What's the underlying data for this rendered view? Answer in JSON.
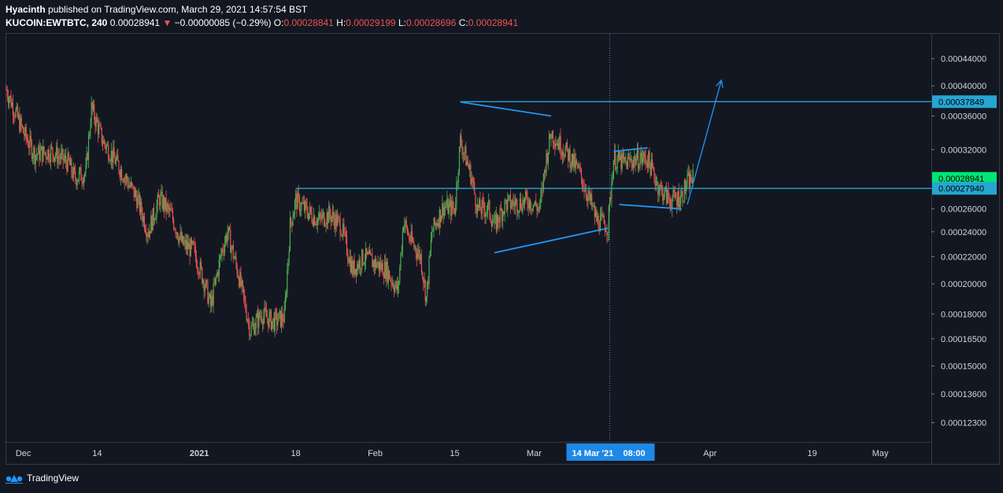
{
  "header": {
    "author": "Hyacinth",
    "published_text": "published on TradingView.com, March 29, 2021 14:57:54 BST",
    "symbol": "KUCOIN:EWTBTC, 240",
    "last_price": "0.00028941",
    "change_arrow": "▼",
    "change": "−0.00000085 (−0.29%)",
    "o_label": "O:",
    "o_value": "0.00028841",
    "h_label": "H:",
    "h_value": "0.00029199",
    "l_label": "L:",
    "l_value": "0.00028696",
    "c_label": "C:",
    "c_value": "0.00028941"
  },
  "footer": {
    "brand": "TradingView"
  },
  "colors": {
    "background": "#131722",
    "up_candle": "#4caf50",
    "down_candle": "#ef5350",
    "drawing_blue": "#2196f3",
    "hline_blue": "#26a6d1",
    "last_price_label": "#00e676",
    "crosshair_label": "#1e88e5"
  },
  "chart_data": {
    "type": "candlestick",
    "price_scale": "log",
    "ylim": [
      0.000115,
      0.00048
    ],
    "y_ticks": [
      "0.00044000",
      "0.00040000",
      "0.00036000",
      "0.00032000",
      "0.00026000",
      "0.00024000",
      "0.00022000",
      "0.00020000",
      "0.00018000",
      "0.00016500",
      "0.00015000",
      "0.00013600",
      "0.00012300"
    ],
    "y_tick_values": [
      0.00044,
      0.0004,
      0.00036,
      0.00032,
      0.00026,
      0.00024,
      0.00022,
      0.0002,
      0.00018,
      0.000165,
      0.00015,
      0.000136,
      0.000123
    ],
    "x_ticks": [
      {
        "label": "Dec",
        "date": "2020-12-01"
      },
      {
        "label": "14",
        "date": "2020-12-14"
      },
      {
        "label": "2021",
        "date": "2021-01-01"
      },
      {
        "label": "18",
        "date": "2021-01-18"
      },
      {
        "label": "Feb",
        "date": "2021-02-01"
      },
      {
        "label": "15",
        "date": "2021-02-15"
      },
      {
        "label": "Mar",
        "date": "2021-03-01"
      },
      {
        "label": "Apr",
        "date": "2021-04-01"
      },
      {
        "label": "19",
        "date": "2021-04-19"
      },
      {
        "label": "May",
        "date": "2021-05-01"
      }
    ],
    "x_range": [
      "2020-11-28",
      "2021-05-10"
    ],
    "crosshair": {
      "date_label": "14 Mar '21",
      "time_label": "08:00",
      "date": "2021-03-14T08:00"
    },
    "price_labels": [
      {
        "value": 0.00037849,
        "text": "0.00037849",
        "kind": "hline"
      },
      {
        "value": 0.00028941,
        "text": "0.00028941",
        "kind": "last"
      },
      {
        "value": 0.0002794,
        "text": "0.00027940",
        "kind": "hline"
      }
    ],
    "horizontal_lines": [
      {
        "value": 0.00037849,
        "from": "2021-02-16"
      },
      {
        "value": 0.0002794,
        "from": "2021-01-18"
      }
    ],
    "trend_lines": [
      {
        "from": {
          "date": "2021-02-16",
          "price": 0.000378
        },
        "to": {
          "date": "2021-03-04",
          "price": 0.00036
        }
      },
      {
        "from": {
          "date": "2021-02-22",
          "price": 0.000223
        },
        "to": {
          "date": "2021-03-14",
          "price": 0.000243
        }
      },
      {
        "from": {
          "date": "2021-03-15",
          "price": 0.000318
        },
        "to": {
          "date": "2021-03-21",
          "price": 0.000322
        }
      },
      {
        "from": {
          "date": "2021-03-16",
          "price": 0.000264
        },
        "to": {
          "date": "2021-03-27",
          "price": 0.00026
        }
      }
    ],
    "arrow": {
      "from": {
        "date": "2021-03-28",
        "price": 0.000264
      },
      "to": {
        "date": "2021-04-03",
        "price": 0.000408
      }
    },
    "price_path": [
      [
        "2020-11-28",
        0.000395
      ],
      [
        "2020-12-01",
        0.00034
      ],
      [
        "2020-12-03",
        0.000315
      ],
      [
        "2020-12-06",
        0.000318
      ],
      [
        "2020-12-09",
        0.000305
      ],
      [
        "2020-12-10",
        0.00029
      ],
      [
        "2020-12-12",
        0.000295
      ],
      [
        "2020-12-13",
        0.00037
      ],
      [
        "2020-12-15",
        0.00033
      ],
      [
        "2020-12-17",
        0.00031
      ],
      [
        "2020-12-19",
        0.00029
      ],
      [
        "2020-12-21",
        0.00027
      ],
      [
        "2020-12-23",
        0.00024
      ],
      [
        "2020-12-25",
        0.00027
      ],
      [
        "2020-12-27",
        0.000255
      ],
      [
        "2020-12-29",
        0.00023
      ],
      [
        "2020-12-31",
        0.000225
      ],
      [
        "2021-01-02",
        0.0002
      ],
      [
        "2021-01-03",
        0.000185
      ],
      [
        "2021-01-05",
        0.000225
      ],
      [
        "2021-01-06",
        0.00024
      ],
      [
        "2021-01-08",
        0.000205
      ],
      [
        "2021-01-10",
        0.00017
      ],
      [
        "2021-01-12",
        0.00018
      ],
      [
        "2021-01-14",
        0.000175
      ],
      [
        "2021-01-16",
        0.000178
      ],
      [
        "2021-01-17",
        0.000245
      ],
      [
        "2021-01-18",
        0.000268
      ],
      [
        "2021-01-20",
        0.000258
      ],
      [
        "2021-01-22",
        0.00025
      ],
      [
        "2021-01-24",
        0.000255
      ],
      [
        "2021-01-26",
        0.000245
      ],
      [
        "2021-01-28",
        0.00021
      ],
      [
        "2021-01-30",
        0.00022
      ],
      [
        "2021-02-01",
        0.000215
      ],
      [
        "2021-02-03",
        0.00021
      ],
      [
        "2021-02-05",
        0.000195
      ],
      [
        "2021-02-06",
        0.00025
      ],
      [
        "2021-02-07",
        0.000235
      ],
      [
        "2021-02-09",
        0.00022
      ],
      [
        "2021-02-10",
        0.00019
      ],
      [
        "2021-02-11",
        0.00024
      ],
      [
        "2021-02-13",
        0.000262
      ],
      [
        "2021-02-15",
        0.00026
      ],
      [
        "2021-02-16",
        0.00033
      ],
      [
        "2021-02-17",
        0.00031
      ],
      [
        "2021-02-18",
        0.00029
      ],
      [
        "2021-02-19",
        0.00026
      ],
      [
        "2021-02-21",
        0.00026
      ],
      [
        "2021-02-22",
        0.000245
      ],
      [
        "2021-02-24",
        0.000265
      ],
      [
        "2021-02-26",
        0.000265
      ],
      [
        "2021-02-28",
        0.000268
      ],
      [
        "2021-03-02",
        0.00026
      ],
      [
        "2021-03-03",
        0.000305
      ],
      [
        "2021-03-04",
        0.00034
      ],
      [
        "2021-03-05",
        0.00033
      ],
      [
        "2021-03-07",
        0.000315
      ],
      [
        "2021-03-09",
        0.000295
      ],
      [
        "2021-03-11",
        0.000265
      ],
      [
        "2021-03-12",
        0.00025
      ],
      [
        "2021-03-14",
        0.000245
      ],
      [
        "2021-03-15",
        0.00031
      ],
      [
        "2021-03-17",
        0.000305
      ],
      [
        "2021-03-19",
        0.00031
      ],
      [
        "2021-03-21",
        0.00031
      ],
      [
        "2021-03-23",
        0.00028
      ],
      [
        "2021-03-25",
        0.000268
      ],
      [
        "2021-03-27",
        0.000272
      ],
      [
        "2021-03-28",
        0.000285
      ],
      [
        "2021-03-29",
        0.00028941
      ]
    ]
  }
}
